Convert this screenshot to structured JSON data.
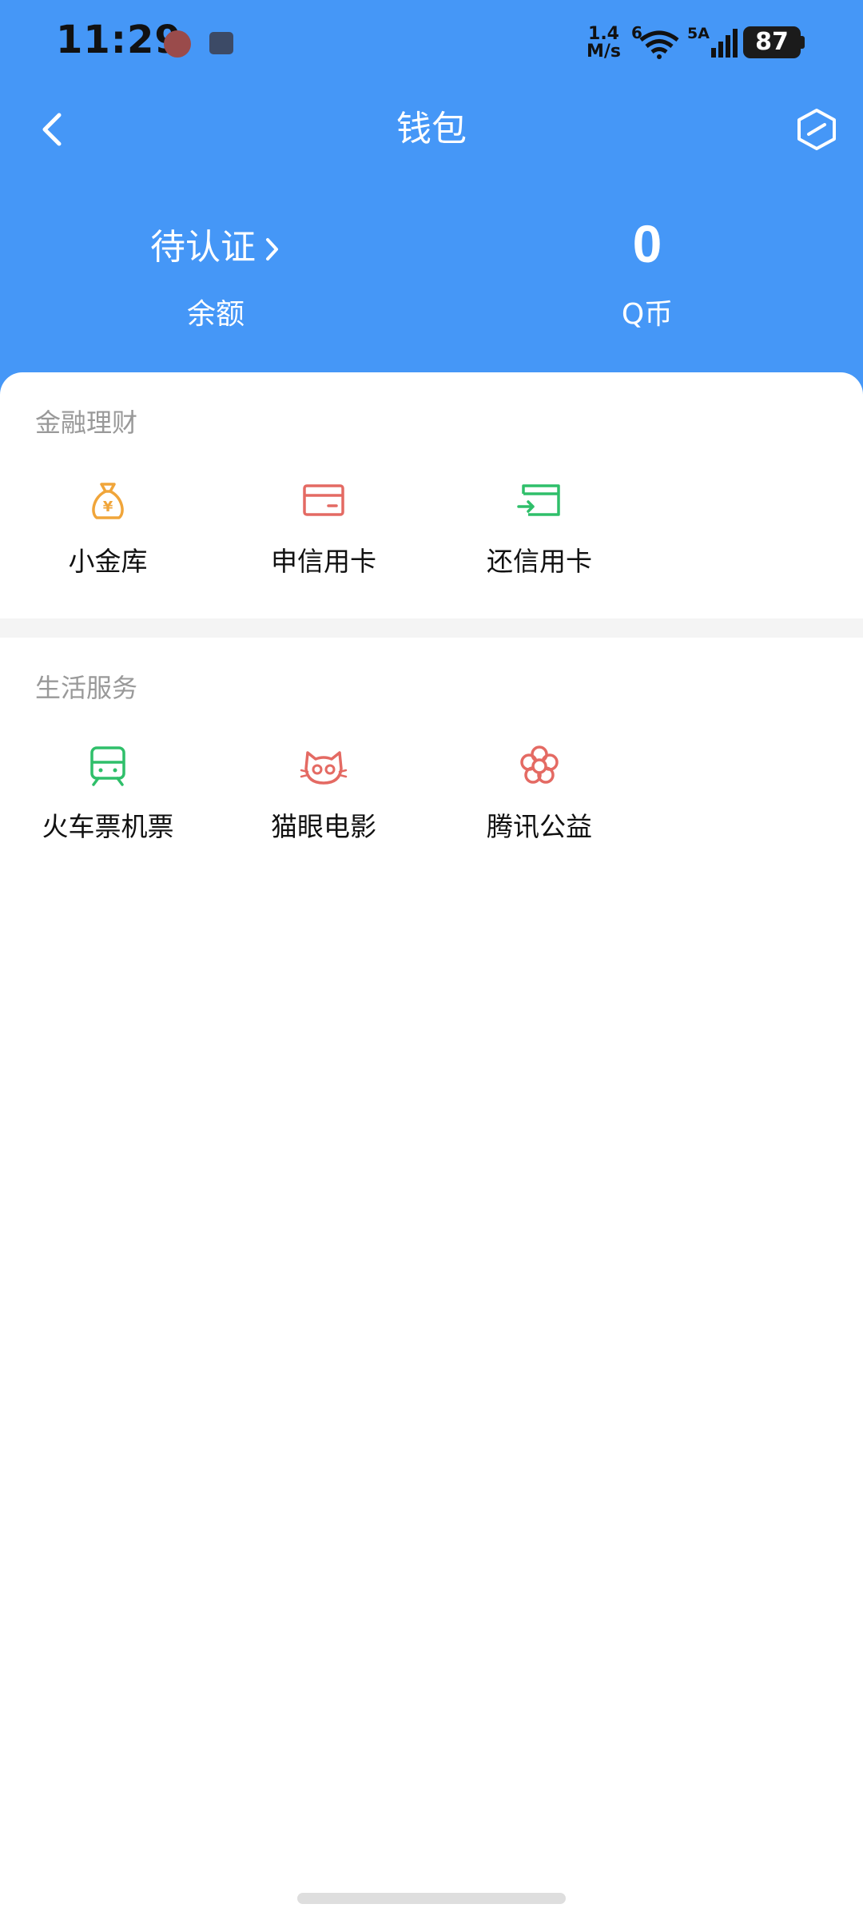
{
  "status_bar": {
    "time": "11:29",
    "net_speed_value": "1.4",
    "net_speed_unit": "M/s",
    "wifi_badge": "6",
    "cell_badge": "5A",
    "battery": "87"
  },
  "title_bar": {
    "title": "钱包",
    "back_icon": "chevron-left-icon",
    "settings_icon": "hexagon-settings-icon"
  },
  "balance": {
    "verify_text": "待认证",
    "balance_label": "余额",
    "qcoin_value": "0",
    "qcoin_label": "Q币"
  },
  "finance": {
    "title": "金融理财",
    "items": [
      {
        "label": "小金库",
        "icon": "money-bag-icon",
        "color": "#F0A53A"
      },
      {
        "label": "申信用卡",
        "icon": "credit-card-icon",
        "color": "#E46A63"
      },
      {
        "label": "还信用卡",
        "icon": "card-repay-icon",
        "color": "#2FBF6A"
      }
    ]
  },
  "life": {
    "title": "生活服务",
    "items": [
      {
        "label": "火车票机票",
        "icon": "train-icon",
        "color": "#2FBF6A"
      },
      {
        "label": "猫眼电影",
        "icon": "cat-eye-icon",
        "color": "#E46A63"
      },
      {
        "label": "腾讯公益",
        "icon": "flower-icon",
        "color": "#E46A63"
      }
    ]
  },
  "colors": {
    "header_blue": "#4597F7",
    "section_gray": "#999999",
    "separator": "#F4F4F4"
  }
}
